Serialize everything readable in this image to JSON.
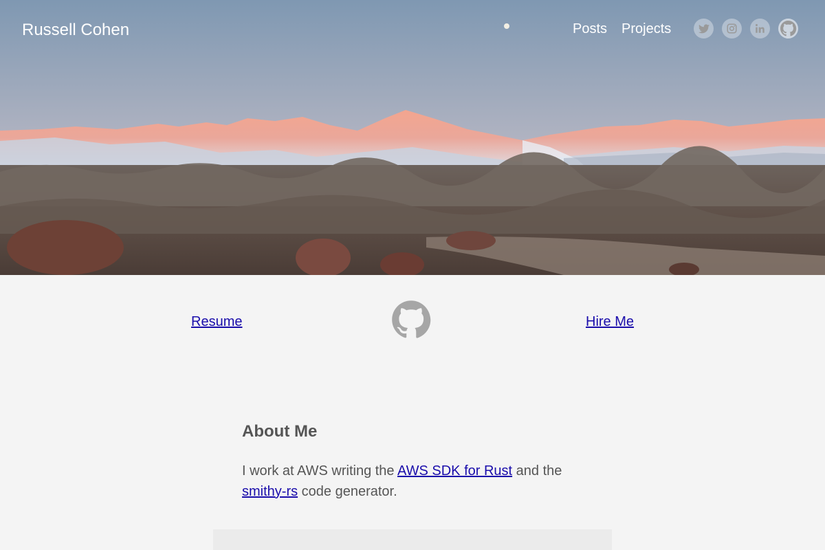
{
  "header": {
    "site_title": "Russell Cohen",
    "nav": [
      {
        "label": "Posts"
      },
      {
        "label": "Projects"
      }
    ],
    "social_icons": [
      "twitter-icon",
      "instagram-icon",
      "linkedin-icon",
      "github-icon"
    ]
  },
  "hero": {
    "image": "mountain-desert-sunrise",
    "colors": {
      "sky_top": "#8aa1b8",
      "sky_bottom": "#d8c4c0",
      "mountain_glow": "#e8a08e",
      "snow": "#e8ecf2",
      "brush": "#6a5e55",
      "ground": "#5a4a42"
    }
  },
  "links": {
    "resume_label": "Resume",
    "hire_label": "Hire Me"
  },
  "about": {
    "heading": "About Me",
    "text_before": "I work at AWS writing the ",
    "link1": "AWS SDK for Rust",
    "text_middle": " and the ",
    "link2": "smithy-rs",
    "text_after": " code generator."
  },
  "colors": {
    "background": "#f4f4f4",
    "link": "#1a0dab",
    "text": "#555555"
  }
}
